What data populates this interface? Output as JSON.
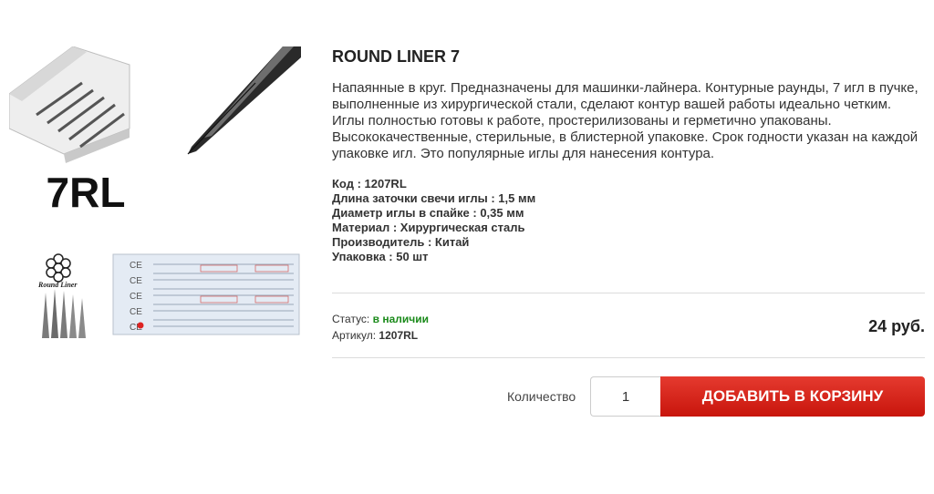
{
  "gallery": {
    "label_7rl": "7RL",
    "label_round_liner": "Round Liner",
    "package_text": "CE"
  },
  "product": {
    "title": "ROUND LINER 7",
    "description": "Напаянные в круг. Предназначены для машинки-лайнера. Контурные раунды, 7 игл в пучке, выполненные из хирургической стали, сделают контур вашей работы идеально четким. Иглы полностью готовы к работе, простерилизованы и герметично упакованы. Высококачественные, стерильные, в блистерной упаковке. Срок годности указан на каждой упаковке игл. Это популярные иглы для нанесения контура.",
    "specs": [
      "Код : 1207RL",
      "Длина заточки свечи иглы : 1,5 мм",
      "Диаметр иглы в спайке : 0,35 мм",
      "Материал : Хирургическая сталь",
      "Производитель : Китай",
      "Упаковка : 50 шт"
    ]
  },
  "status": {
    "label": "Статус:",
    "value": "в наличии",
    "sku_label": "Артикул:",
    "sku_value": "1207RL",
    "status_color": "#1a8a1a"
  },
  "price": "24 руб.",
  "cart": {
    "qty_label": "Количество",
    "qty_value": "1",
    "add_label": "ДОБАВИТЬ В КОРЗИНУ",
    "button_color": "#d9261c"
  }
}
